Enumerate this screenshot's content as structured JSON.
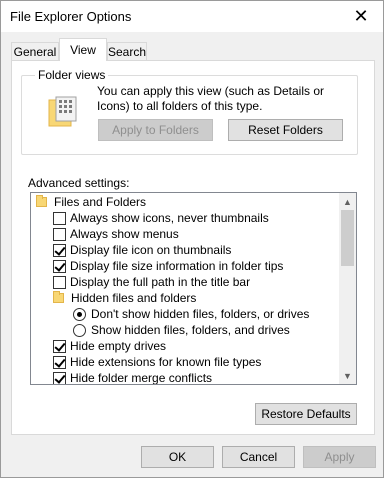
{
  "window": {
    "title": "File Explorer Options",
    "close_icon": "close-icon"
  },
  "tabs": [
    {
      "label": "General",
      "active": false
    },
    {
      "label": "View",
      "active": true
    },
    {
      "label": "Search",
      "active": false
    }
  ],
  "folder_views": {
    "title": "Folder views",
    "description": "You can apply this view (such as Details or Icons) to all folders of this type.",
    "apply_label": "Apply to Folders",
    "reset_label": "Reset Folders"
  },
  "advanced": {
    "label": "Advanced settings:",
    "items": [
      {
        "kind": "folder",
        "label": "Files and Folders",
        "indent": 0
      },
      {
        "kind": "checkbox",
        "label": "Always show icons, never thumbnails",
        "checked": false,
        "indent": 1
      },
      {
        "kind": "checkbox",
        "label": "Always show menus",
        "checked": false,
        "indent": 1
      },
      {
        "kind": "checkbox",
        "label": "Display file icon on thumbnails",
        "checked": true,
        "indent": 1
      },
      {
        "kind": "checkbox",
        "label": "Display file size information in folder tips",
        "checked": true,
        "indent": 1
      },
      {
        "kind": "checkbox",
        "label": "Display the full path in the title bar",
        "checked": false,
        "indent": 1
      },
      {
        "kind": "folder",
        "label": "Hidden files and folders",
        "indent": 1
      },
      {
        "kind": "radio",
        "label": "Don't show hidden files, folders, or drives",
        "selected": true,
        "indent": 2
      },
      {
        "kind": "radio",
        "label": "Show hidden files, folders, and drives",
        "selected": false,
        "indent": 2
      },
      {
        "kind": "checkbox",
        "label": "Hide empty drives",
        "checked": true,
        "indent": 1
      },
      {
        "kind": "checkbox",
        "label": "Hide extensions for known file types",
        "checked": true,
        "indent": 1
      },
      {
        "kind": "checkbox",
        "label": "Hide folder merge conflicts",
        "checked": true,
        "indent": 1
      }
    ],
    "restore_label": "Restore Defaults"
  },
  "footer": {
    "ok_label": "OK",
    "cancel_label": "Cancel",
    "apply_label": "Apply"
  },
  "colors": {
    "folder": "#f8d775",
    "disabled_text": "#8f8f8f"
  }
}
